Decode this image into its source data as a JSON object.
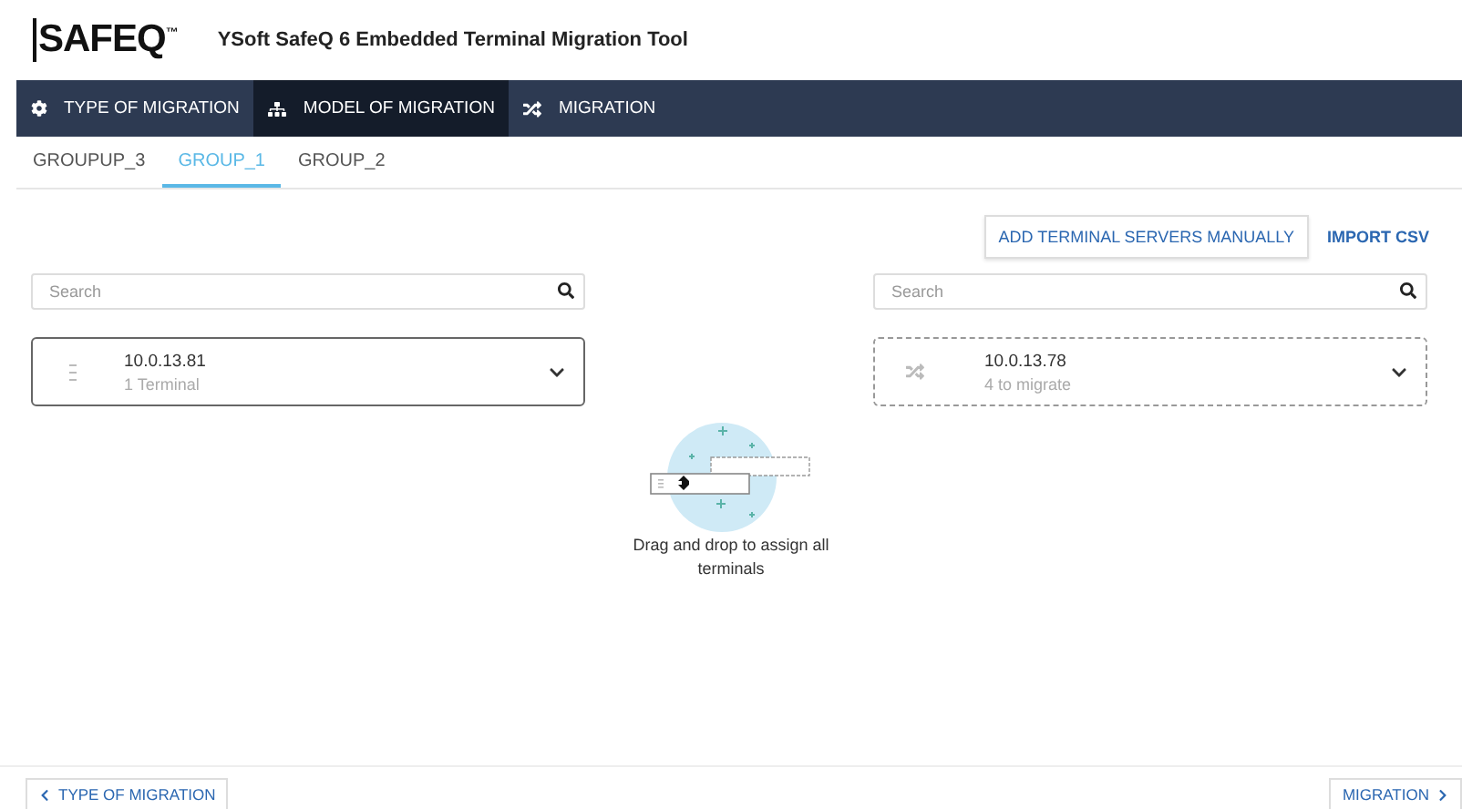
{
  "header": {
    "logo": "SAFEQ",
    "logo_mark": "™",
    "title": "YSoft SafeQ 6 Embedded Terminal Migration Tool"
  },
  "steps": [
    {
      "label": "TYPE OF MIGRATION",
      "kind": "settings",
      "selected": false
    },
    {
      "label": "MODEL OF MIGRATION",
      "kind": "model",
      "selected": true
    },
    {
      "label": "MIGRATION",
      "kind": "migration",
      "selected": false
    }
  ],
  "groups": [
    {
      "label": "GROUPUP_3",
      "selected": false
    },
    {
      "label": "GROUP_1",
      "selected": true
    },
    {
      "label": "GROUP_2",
      "selected": false
    }
  ],
  "actions": [
    "ADD TERMINAL SERVERS MANUALLY",
    "IMPORT CSV"
  ],
  "columns": [
    {
      "search": {
        "placeholder": "Search"
      },
      "server": {
        "kind": "assigned",
        "address": "10.0.13.81",
        "detail": "1 Terminal"
      }
    },
    {
      "search": {
        "placeholder": "Search"
      },
      "server": {
        "kind": "pending",
        "address": "10.0.13.78",
        "detail": "4 to migrate"
      }
    }
  ],
  "hint": "Drag and drop to assign all terminals",
  "footer": {
    "back": "TYPE OF MIGRATION",
    "next": "MIGRATION"
  }
}
